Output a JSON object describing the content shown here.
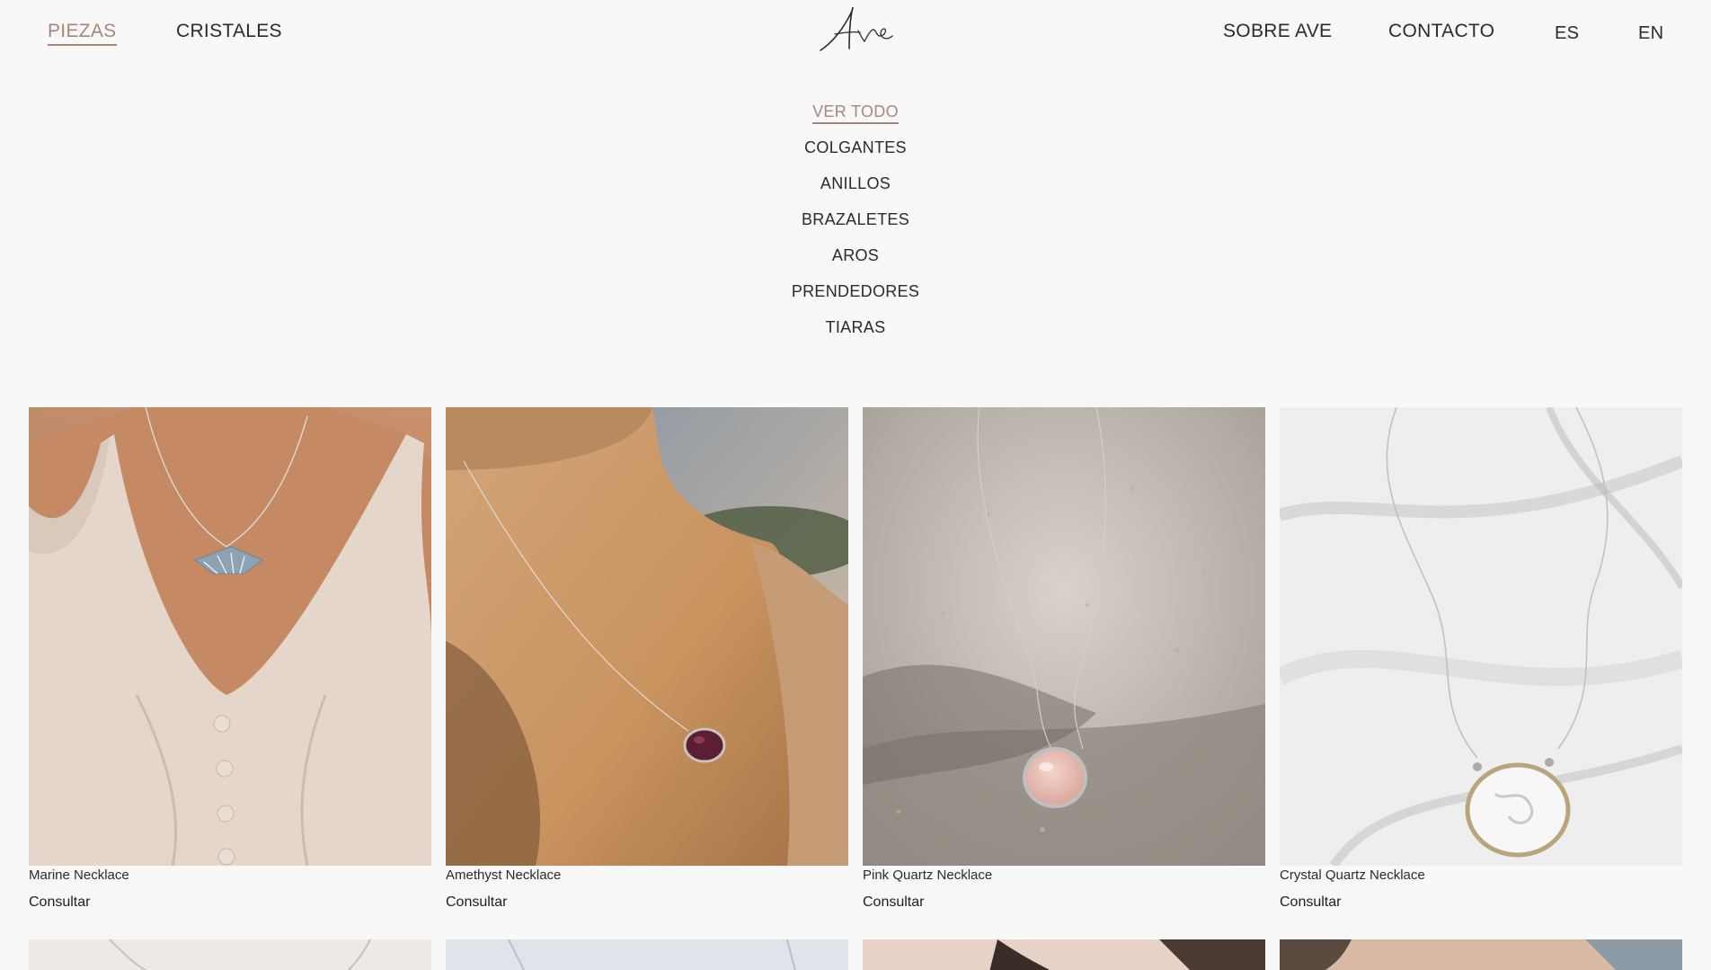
{
  "nav": {
    "left": [
      {
        "label": "PIEZAS",
        "active": true
      },
      {
        "label": "CRISTALES",
        "active": false
      }
    ],
    "right": [
      {
        "label": "SOBRE AVE"
      },
      {
        "label": "CONTACTO"
      }
    ],
    "languages": [
      "ES",
      "EN"
    ]
  },
  "logo": {
    "alt": "Ave"
  },
  "submenu": {
    "items": [
      "VER TODO",
      "COLGANTES",
      "ANILLOS",
      "BRAZALETES",
      "AROS",
      "PRENDEDORES",
      "TIARAS"
    ],
    "active_index": 0
  },
  "products": [
    {
      "name": "Marine Necklace",
      "cta": "Consultar"
    },
    {
      "name": "Amethyst Necklace",
      "cta": "Consultar"
    },
    {
      "name": "Pink Quartz Necklace",
      "cta": "Consultar"
    },
    {
      "name": "Crystal Quartz Necklace",
      "cta": "Consultar"
    }
  ],
  "colors": {
    "background": "#f8f8f8",
    "accent": "#a7877c",
    "text": "#2b2b2b"
  }
}
